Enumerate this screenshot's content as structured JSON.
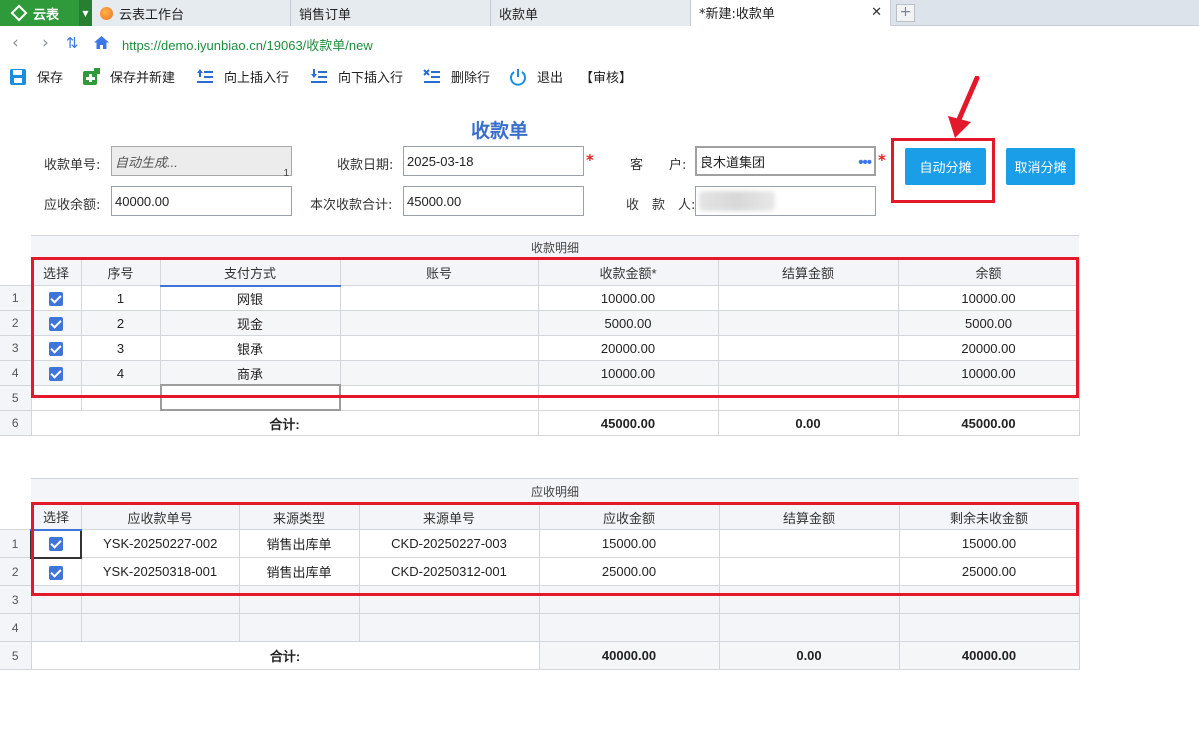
{
  "app": {
    "name": "云表"
  },
  "tabs": [
    {
      "label": "云表工作台"
    },
    {
      "label": "销售订单"
    },
    {
      "label": "收款单"
    },
    {
      "label": "*新建:收款单"
    }
  ],
  "address": {
    "url": "https://demo.iyunbiao.cn/19063/收款单/new"
  },
  "toolbar": {
    "save": "保存",
    "save_new": "保存并新建",
    "insert_up": "向上插入行",
    "insert_down": "向下插入行",
    "delete_row": "删除行",
    "exit": "退出",
    "audit": "【审核】"
  },
  "form": {
    "title": "收款单",
    "no_label": "收款单号:",
    "no_value": "自动生成...",
    "no_hint": "1",
    "date_label": "收款日期:",
    "date_value": "2025-03-18",
    "customer_label": "客　　户:",
    "customer_value": "良木道集团",
    "balance_label": "应收余额:",
    "balance_value": "40000.00",
    "total_label": "本次收款合计:",
    "total_value": "45000.00",
    "payee_label": "收　款　人:",
    "auto_btn": "自动分摊",
    "cancel_btn": "取消分摊"
  },
  "receipt_grid": {
    "title": "收款明细",
    "headers": [
      "选择",
      "序号",
      "支付方式",
      "账号",
      "收款金额*",
      "结算金额",
      "余额"
    ],
    "row_numbers": [
      "1",
      "2",
      "3",
      "4",
      "5",
      "6"
    ],
    "rows": [
      {
        "seq": "1",
        "method": "网银",
        "account": "",
        "amount": "10000.00",
        "settle": "",
        "balance": "10000.00"
      },
      {
        "seq": "2",
        "method": "现金",
        "account": "",
        "amount": "5000.00",
        "settle": "",
        "balance": "5000.00"
      },
      {
        "seq": "3",
        "method": "银承",
        "account": "",
        "amount": "20000.00",
        "settle": "",
        "balance": "20000.00"
      },
      {
        "seq": "4",
        "method": "商承",
        "account": "",
        "amount": "10000.00",
        "settle": "",
        "balance": "10000.00"
      }
    ],
    "sum_label": "合计:",
    "sum_amount": "45000.00",
    "sum_settle": "0.00",
    "sum_balance": "45000.00"
  },
  "ar_grid": {
    "title": "应收明细",
    "headers": [
      "选择",
      "应收款单号",
      "来源类型",
      "来源单号",
      "应收金额",
      "结算金额",
      "剩余未收金额"
    ],
    "row_numbers": [
      "1",
      "2",
      "3",
      "4",
      "5"
    ],
    "rows": [
      {
        "no": "YSK-20250227-002",
        "type": "销售出库单",
        "source": "CKD-20250227-003",
        "amount": "15000.00",
        "settle": "",
        "remain": "15000.00"
      },
      {
        "no": "YSK-20250318-001",
        "type": "销售出库单",
        "source": "CKD-20250312-001",
        "amount": "25000.00",
        "settle": "",
        "remain": "25000.00"
      }
    ],
    "sum_label": "合计:",
    "sum_amount": "40000.00",
    "sum_settle": "0.00",
    "sum_remain": "40000.00"
  },
  "colors": {
    "accent": "#1a9ee8",
    "highlight": "#e3192b",
    "brand": "#2e9a3a",
    "title": "#3a6fc9"
  }
}
